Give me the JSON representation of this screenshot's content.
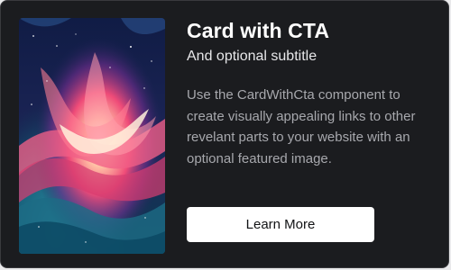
{
  "card": {
    "title": "Card with CTA",
    "subtitle": "And optional subtitle",
    "description": "Use the CardWithCta component to create visually appealing links to other revelant parts to your website with an optional featured image.",
    "cta_label": "Learn More"
  },
  "colors": {
    "card_background": "#1b1c1f",
    "title": "#ffffff",
    "description": "#a7a8ad",
    "button_background": "#ffffff",
    "button_text": "#111214"
  }
}
